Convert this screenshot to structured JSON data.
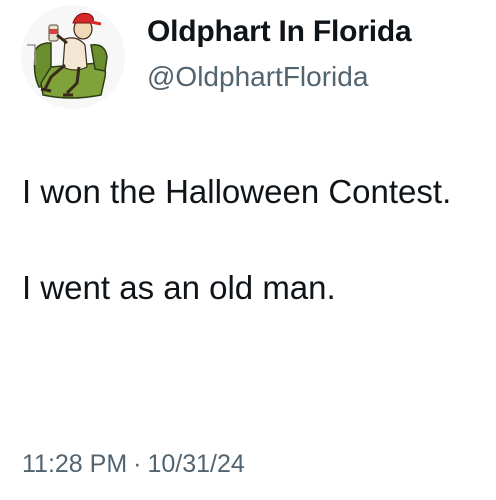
{
  "author": {
    "display_name": "Oldphart In Florida",
    "handle": "@OldphartFlorida",
    "avatar_icon": "old-man-in-armchair-avatar"
  },
  "tweet": {
    "lines": [
      "I won the Halloween Contest.",
      "I went as an old man."
    ]
  },
  "meta": {
    "time": "11:28 PM",
    "separator": "·",
    "date": "10/31/24"
  },
  "colors": {
    "text": "#0f1419",
    "secondary": "#536471",
    "chair": "#6b8f2e",
    "cap": "#d62828"
  }
}
